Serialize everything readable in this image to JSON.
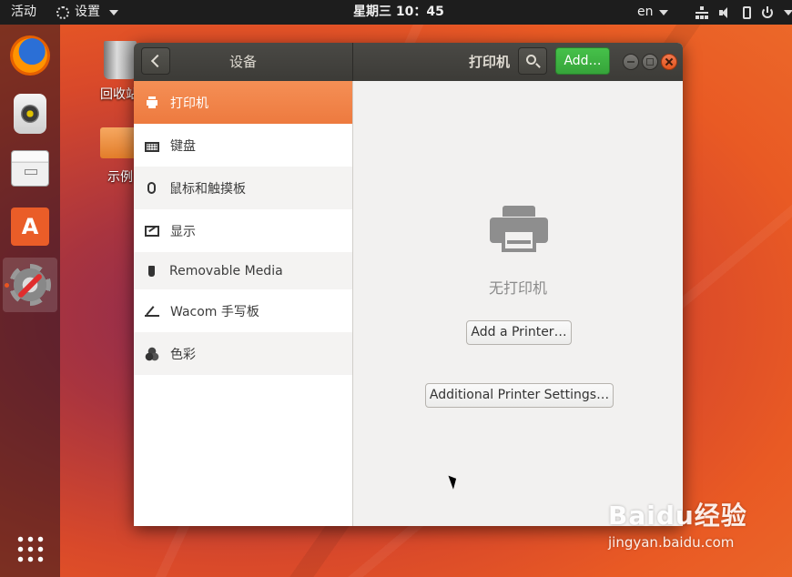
{
  "topbar": {
    "activities": "活动",
    "app_menu": "设置",
    "clock": "星期三 10：45",
    "language": "en",
    "tray_icons": [
      "network-icon",
      "volume-icon",
      "battery-icon",
      "power-icon"
    ]
  },
  "dock": {
    "apps": [
      "firefox",
      "rhythmbox",
      "files",
      "ubuntu-software",
      "settings"
    ],
    "active_app": "settings"
  },
  "desktop": {
    "icons": [
      {
        "label": "回收站",
        "icon": "trash-icon"
      },
      {
        "label": "示例",
        "icon": "folder-icon"
      }
    ]
  },
  "window": {
    "sidebar_title": "设备",
    "panel_title": "打印机",
    "add_button": "Add…",
    "sidebar_items": [
      {
        "label": "打印机",
        "icon": "printer-icon",
        "selected": true
      },
      {
        "label": "键盘",
        "icon": "keyboard-icon"
      },
      {
        "label": "鼠标和触摸板",
        "icon": "mouse-icon"
      },
      {
        "label": "显示",
        "icon": "display-icon"
      },
      {
        "label": "Removable Media",
        "icon": "usb-icon"
      },
      {
        "label": "Wacom 手写板",
        "icon": "tablet-icon"
      },
      {
        "label": "色彩",
        "icon": "color-icon"
      }
    ],
    "main": {
      "empty_text": "无打印机",
      "add_printer_button": "Add a Printer…",
      "additional_settings_button": "Additional Printer Settings…"
    }
  },
  "watermark": {
    "logo": "Baidu经验",
    "url": "jingyan.baidu.com"
  },
  "colors": {
    "accent_orange": "#ed7a3f",
    "add_green": "#3fb443",
    "headerbar": "#3c3b37"
  }
}
